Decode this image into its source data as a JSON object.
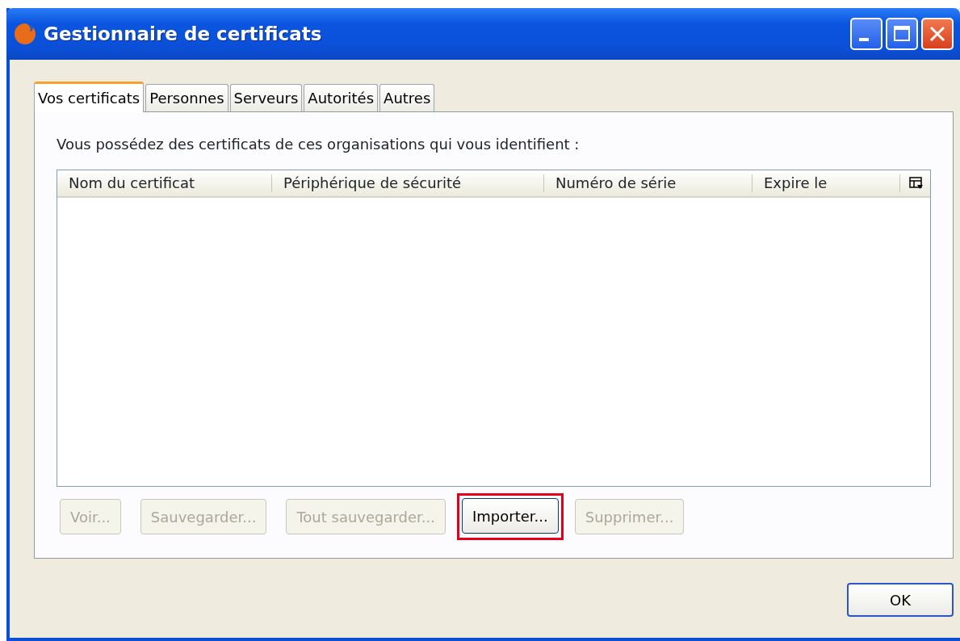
{
  "window": {
    "title": "Gestionnaire de certificats"
  },
  "tabs": [
    {
      "label": "Vos certificats",
      "selected": true
    },
    {
      "label": "Personnes",
      "selected": false
    },
    {
      "label": "Serveurs",
      "selected": false
    },
    {
      "label": "Autorités",
      "selected": false
    },
    {
      "label": "Autres",
      "selected": false
    }
  ],
  "description": "Vous possédez des certificats de ces organisations qui vous identifient :",
  "table": {
    "columns": [
      "Nom du certificat",
      "Périphérique de sécurité",
      "Numéro de série",
      "Expire le"
    ]
  },
  "buttons": [
    {
      "label": "Voir...",
      "disabled": true,
      "highlighted": false
    },
    {
      "label": "Sauvegarder...",
      "disabled": true,
      "highlighted": false
    },
    {
      "label": "Tout sauvegarder...",
      "disabled": true,
      "highlighted": false
    },
    {
      "label": "Importer...",
      "disabled": false,
      "highlighted": true
    },
    {
      "label": "Supprimer...",
      "disabled": true,
      "highlighted": false
    }
  ],
  "ok_button": {
    "label": "OK"
  }
}
